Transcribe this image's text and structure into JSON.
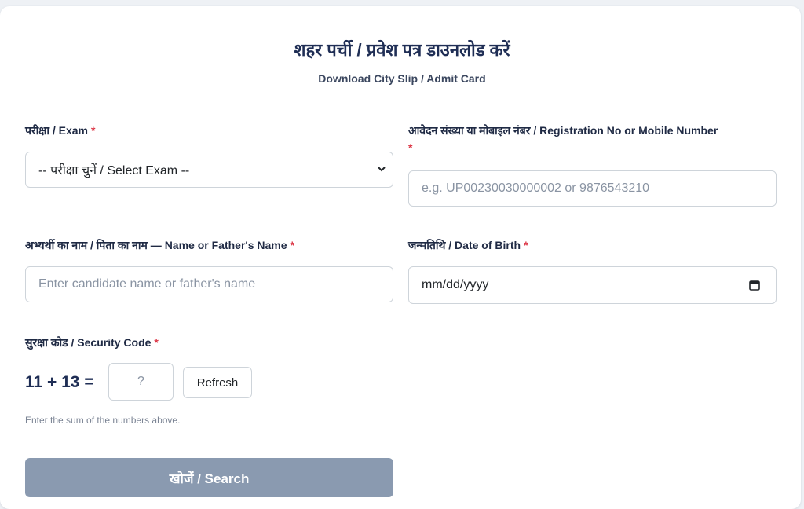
{
  "header": {
    "title": "शहर पर्ची / प्रवेश पत्र डाउनलोड करें",
    "subtitle": "Download City Slip / Admit Card"
  },
  "form": {
    "exam": {
      "label": "परीक्षा / Exam",
      "required": "*",
      "selected": "-- परीक्षा चुनें / Select Exam --"
    },
    "registration": {
      "label": "आवेदन संख्या या मोबाइल नंबर / Registration No or Mobile Number",
      "required": "*",
      "placeholder": "e.g. UP00230030000002 or 9876543210"
    },
    "name": {
      "label": "अभ्यर्थी का नाम / पिता का नाम — Name or Father's Name",
      "required": "*",
      "placeholder": "Enter candidate name or father's name"
    },
    "dob": {
      "label": "जन्मतिथि / Date of Birth",
      "required": "*",
      "value": "mm/dd/yyyy"
    },
    "security": {
      "label": "सुरक्षा कोड / Security Code",
      "required": "*",
      "question": "11 + 13 =",
      "placeholder": "?",
      "refresh_label": "Refresh",
      "hint": "Enter the sum of the numbers above."
    },
    "search_label": "खोजें / Search"
  },
  "colors": {
    "accent": "#1f2e55",
    "required": "#dc3545",
    "button_disabled": "#8a9ab0"
  },
  "icons": {
    "select": "chevron-down-icon",
    "date": "calendar-icon"
  }
}
